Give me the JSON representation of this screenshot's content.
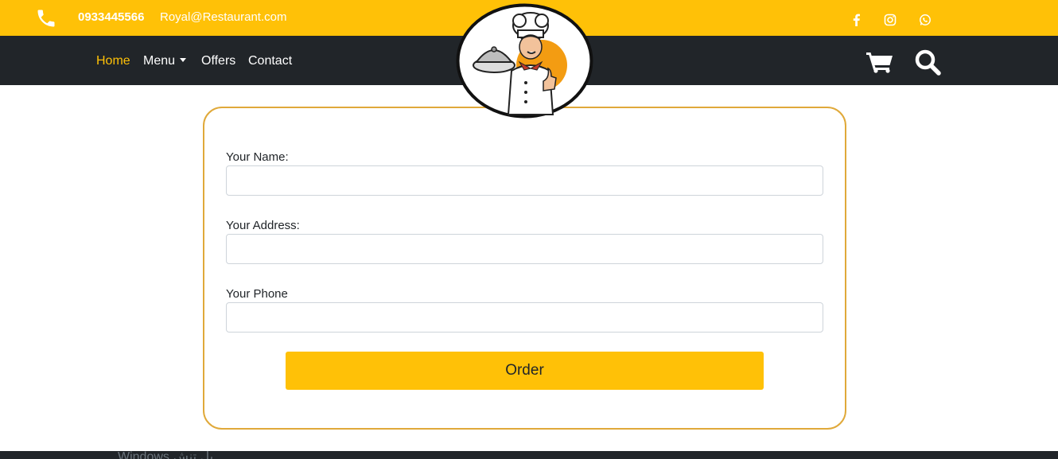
{
  "topbar": {
    "phone": "0933445566",
    "email": "Royal@Restaurant.com",
    "accent_color": "#ffc107",
    "social_icons": [
      "facebook-icon",
      "instagram-icon",
      "whatsapp-icon"
    ]
  },
  "nav": {
    "items": [
      {
        "label": "Home",
        "active": true
      },
      {
        "label": "Menu"
      },
      {
        "label": "Offers"
      },
      {
        "label": "Contact"
      }
    ],
    "right_icons": [
      "cart-icon",
      "search-icon"
    ],
    "background": "#212529"
  },
  "form": {
    "name_label": "Your Name:",
    "name_value": "",
    "address_label": "Your Address:",
    "address_value": "",
    "phone_label": "Your Phone",
    "phone_value": "",
    "submit_label": "Order",
    "border_color": "#e0a93a"
  },
  "overlay": {
    "windows_watermark": "Windows بل تنش"
  }
}
